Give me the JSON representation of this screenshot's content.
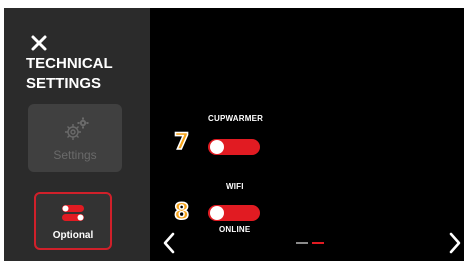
{
  "sidebar": {
    "close_icon": "close-icon",
    "title_line1": "TECHNICAL",
    "title_line2": "SETTINGS",
    "tiles": [
      {
        "label": "Settings",
        "icon": "gear-settings-icon",
        "state": "disabled"
      },
      {
        "label": "Optional",
        "icon": "toggle-options-icon",
        "state": "selected"
      }
    ]
  },
  "options": [
    {
      "badge": "7",
      "label": "CUPWARMER",
      "state": "off"
    },
    {
      "badge": "8",
      "label": "WIFI",
      "sub_label": "ONLINE",
      "state": "off"
    }
  ],
  "navigation": {
    "prev_icon": "chevron-left-icon",
    "next_icon": "chevron-right-icon",
    "pages_total": 2,
    "current_page": 2
  },
  "colors": {
    "accent": "#e11b22",
    "badge": "#f5a31a",
    "sidebar_bg": "#2b2b2b",
    "screen_bg": "#000000"
  }
}
